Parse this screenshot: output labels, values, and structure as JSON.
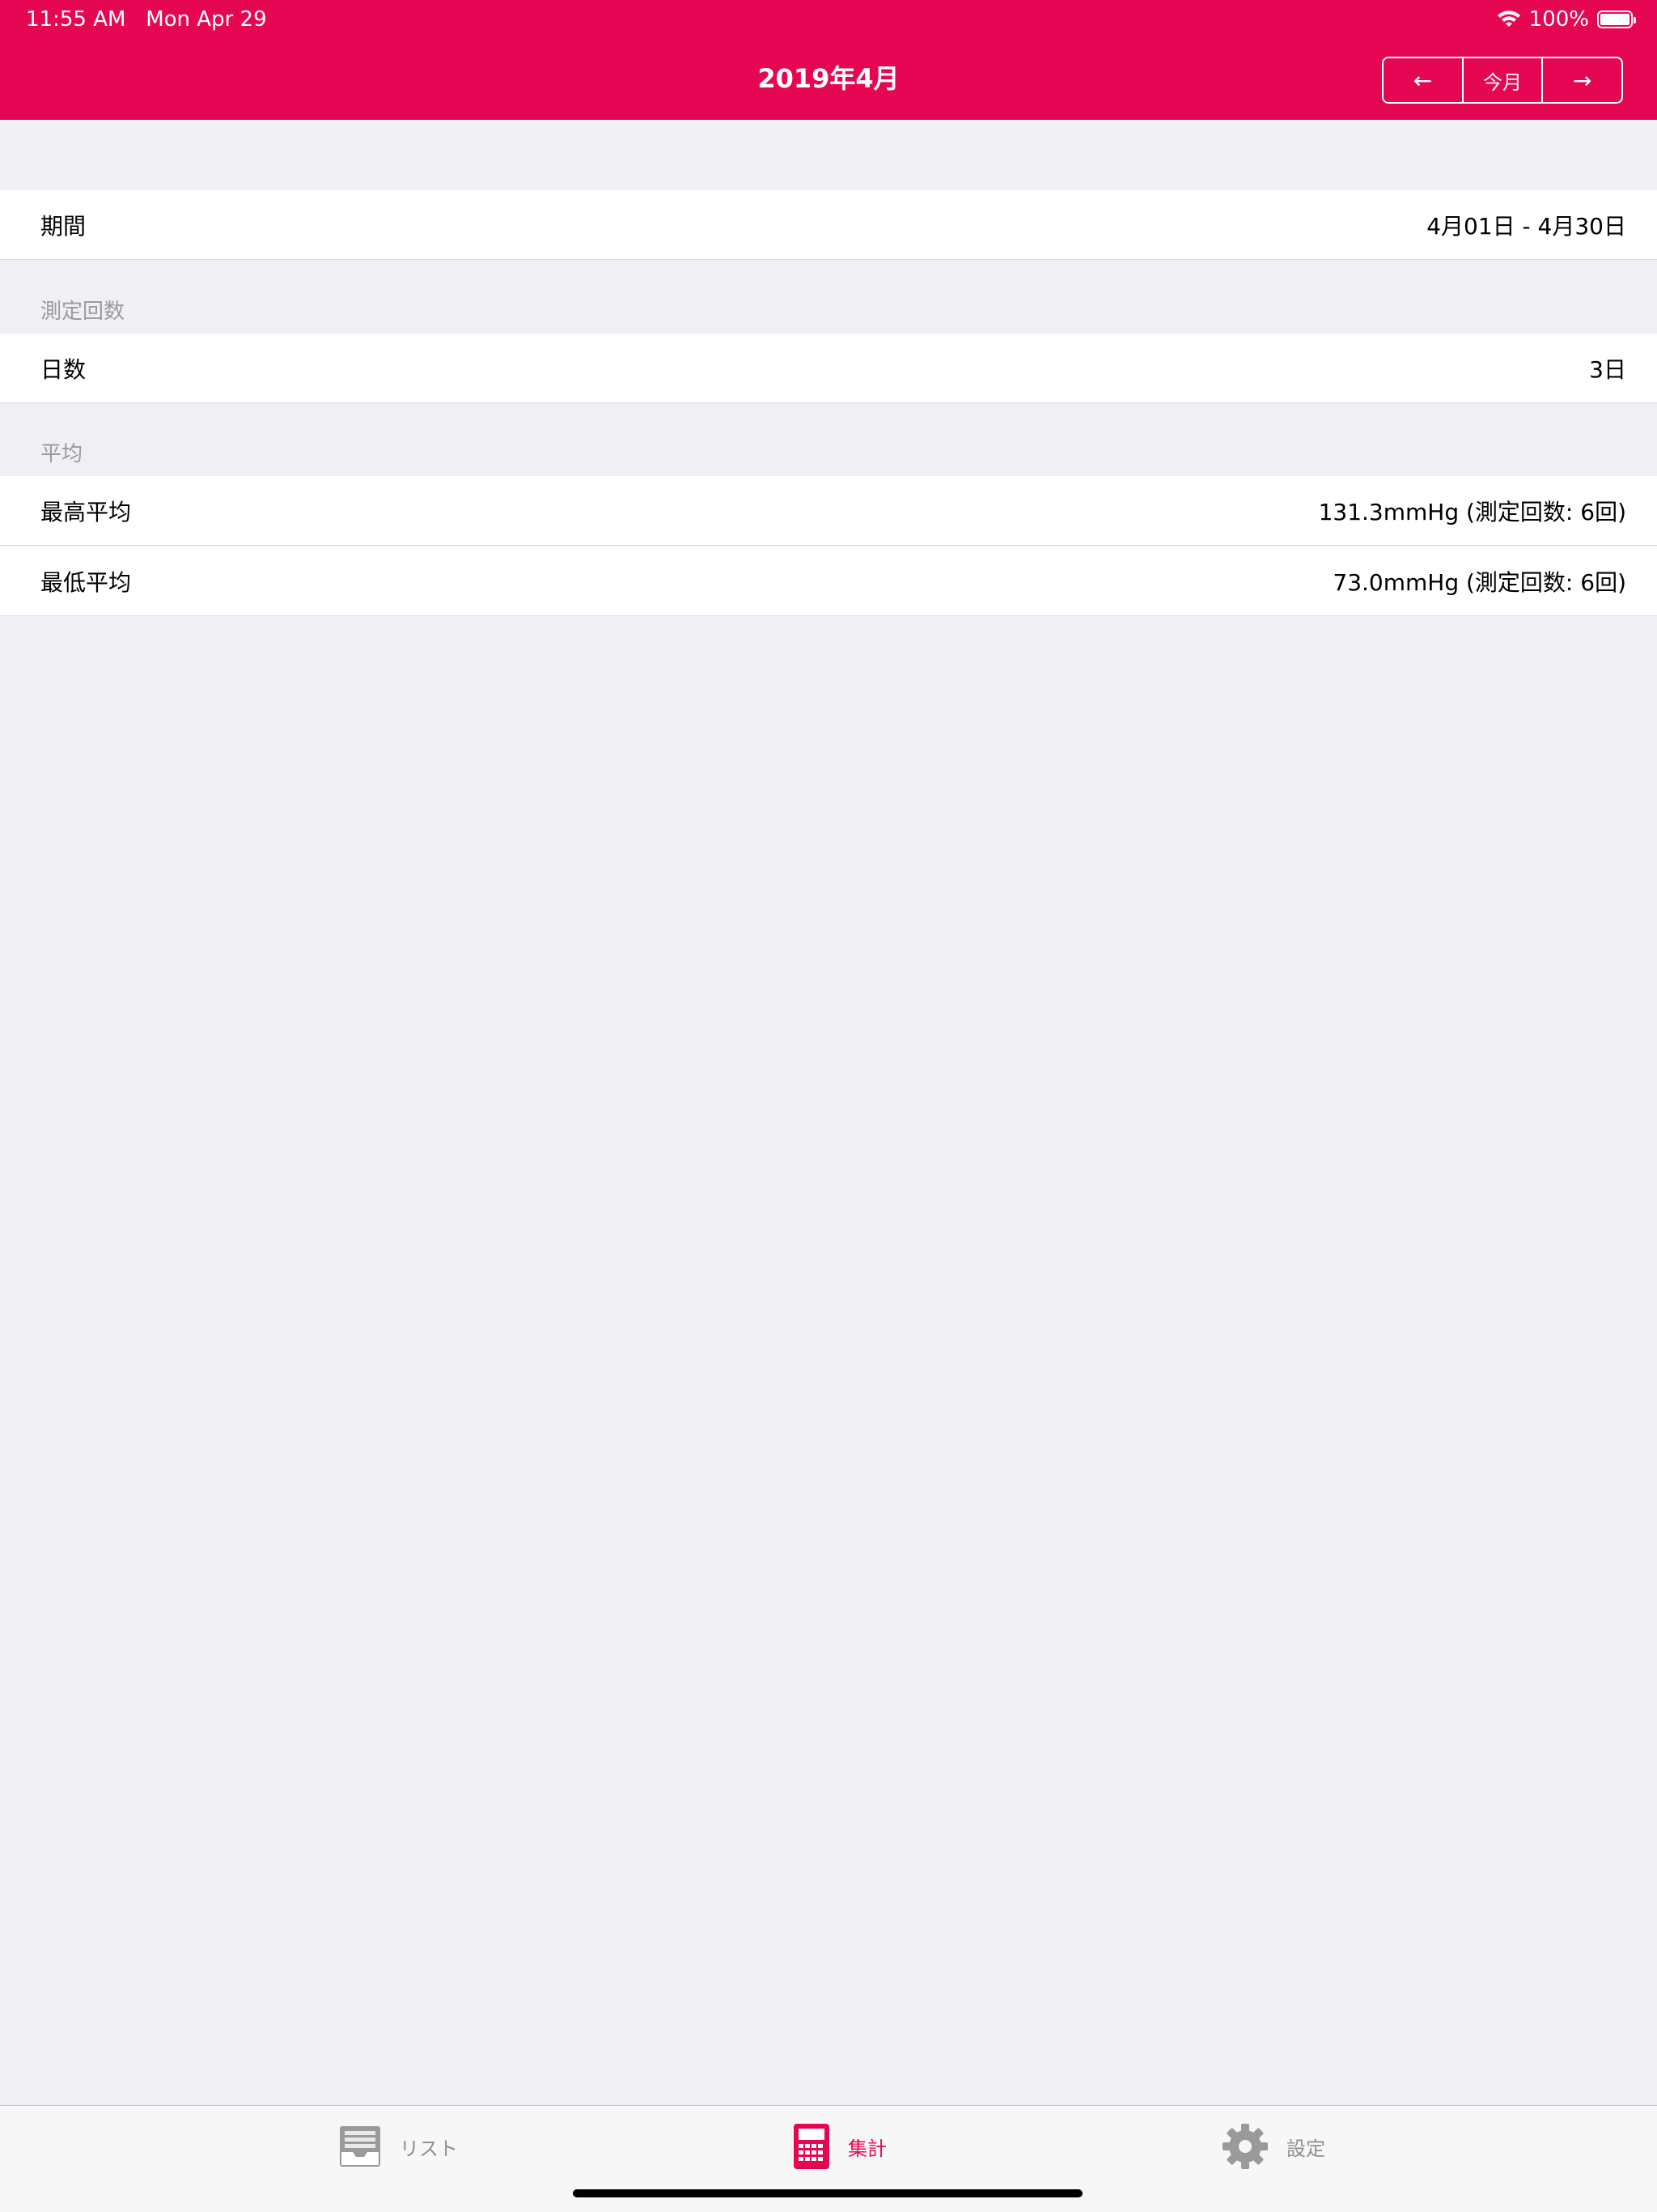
{
  "status_bar": {
    "time": "11:55 AM",
    "date": "Mon Apr 29",
    "battery": "100%"
  },
  "nav": {
    "title": "2019年4月",
    "prev_label": "←",
    "current_label": "今月",
    "next_label": "→"
  },
  "rows": {
    "period": {
      "label": "期間",
      "value": "4月01日 - 4月30日"
    },
    "count_section": "測定回数",
    "days": {
      "label": "日数",
      "value": "3日"
    },
    "average_section": "平均",
    "systolic": {
      "label": "最高平均",
      "value": "131.3mmHg (測定回数: 6回)"
    },
    "diastolic": {
      "label": "最低平均",
      "value": "73.0mmHg (測定回数: 6回)"
    }
  },
  "tabbar": {
    "list_label": "リスト",
    "stats_label": "集計",
    "settings_label": "設定",
    "list_icon": "list-tray-icon",
    "stats_icon": "calculator-icon",
    "settings_icon": "gear-icon"
  },
  "colors": {
    "accent": "#e60754",
    "background": "#efeff4",
    "inactive": "#8e8e93"
  }
}
